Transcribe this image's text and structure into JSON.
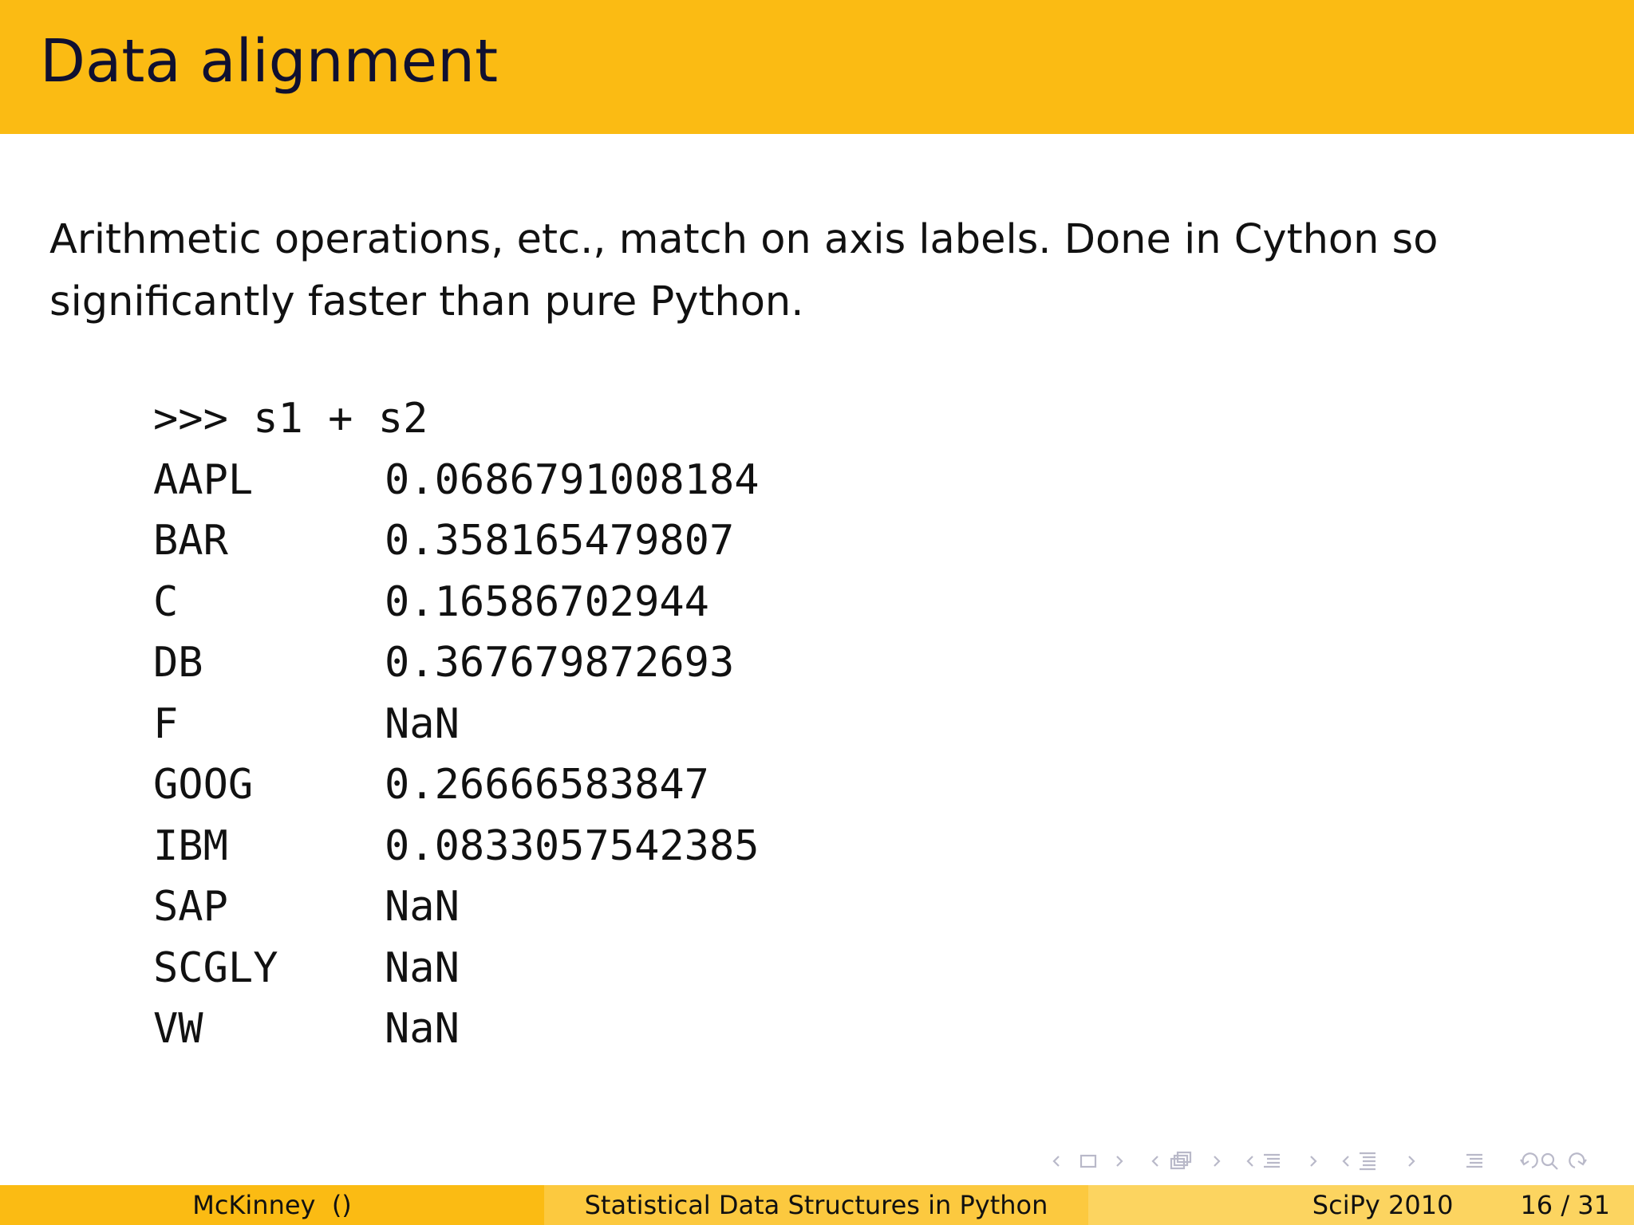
{
  "slide": {
    "title": "Data alignment",
    "paragraph": {
      "line1": "Arithmetic operations, etc., match on axis labels.  Done in Cython so",
      "line2": "significantly faster than pure Python."
    },
    "code": {
      "command": ">>> s1 + s2",
      "rows": [
        {
          "key": "AAPL",
          "value": "0.0686791008184"
        },
        {
          "key": "BAR",
          "value": "0.358165479807"
        },
        {
          "key": "C",
          "value": "0.16586702944"
        },
        {
          "key": "DB",
          "value": "0.367679872693"
        },
        {
          "key": "F",
          "value": "NaN"
        },
        {
          "key": "GOOG",
          "value": "0.26666583847"
        },
        {
          "key": "IBM",
          "value": "0.0833057542385"
        },
        {
          "key": "SAP",
          "value": "NaN"
        },
        {
          "key": "SCGLY",
          "value": "NaN"
        },
        {
          "key": "VW",
          "value": "NaN"
        }
      ]
    }
  },
  "footer": {
    "author": "McKinney  ()",
    "talk_title": "Statistical Data Structures in Python",
    "conference": "SciPy 2010",
    "page": "16 / 31"
  },
  "colors": {
    "header": "#fbbb13",
    "footer_left": "#fbbb13",
    "footer_mid": "#fcc93f",
    "footer_right": "#fcd460",
    "nav_icons": "#b9b9c9"
  },
  "nav_icons": [
    "prev-slide-icon",
    "frame-icon",
    "next-slide-icon",
    "prev-frame-icon",
    "frames-icon",
    "next-frame-icon",
    "prev-subsection-icon",
    "subsection-icon",
    "next-subsection-icon",
    "prev-section-icon",
    "section-icon",
    "next-section-icon",
    "outline-icon",
    "back-icon",
    "search-icon",
    "forward-icon"
  ]
}
